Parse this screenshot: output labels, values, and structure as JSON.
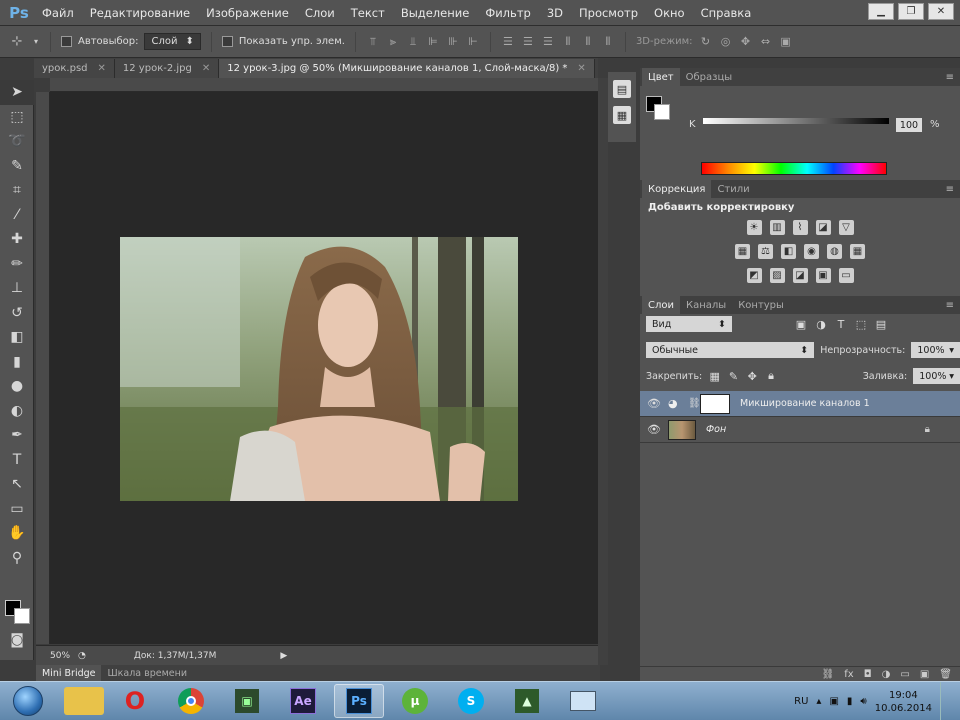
{
  "app": {
    "logo": "Ps"
  },
  "menu": [
    "Файл",
    "Редактирование",
    "Изображение",
    "Слои",
    "Текст",
    "Выделение",
    "Фильтр",
    "3D",
    "Просмотр",
    "Окно",
    "Справка"
  ],
  "options": {
    "autoselect_label": "Автовыбор:",
    "autoselect_value": "Слой",
    "show_controls_label": "Показать упр. элем.",
    "mode3d_label": "3D-режим:"
  },
  "tabs": [
    {
      "label": "урок.psd",
      "active": false
    },
    {
      "label": "12 урок-2.jpg",
      "active": false
    },
    {
      "label": "12 урок-3.jpg @ 50% (Микширование каналов 1, Слой-маска/8) *",
      "active": true
    }
  ],
  "status": {
    "zoom": "50%",
    "doc": "Док: 1,37M/1,37M"
  },
  "bottom_tabs": [
    "Mini Bridge",
    "Шкала времени"
  ],
  "color_panel": {
    "tabs": [
      "Цвет",
      "Образцы"
    ],
    "channel": "K",
    "value": "100",
    "unit": "%"
  },
  "adjustments": {
    "tabs": [
      "Коррекция",
      "Стили"
    ],
    "title": "Добавить корректировку"
  },
  "layers_panel": {
    "tabs": [
      "Слои",
      "Каналы",
      "Контуры"
    ],
    "filter": "Вид",
    "blend_mode": "Обычные",
    "opacity_label": "Непрозрачность:",
    "opacity_value": "100%",
    "lock_label": "Закрепить:",
    "fill_label": "Заливка:",
    "fill_value": "100%",
    "layers": [
      {
        "name": "Микширование каналов 1",
        "selected": true
      },
      {
        "name": "Фон",
        "selected": false
      }
    ]
  },
  "taskbar": {
    "lang": "RU",
    "time": "19:04",
    "date": "10.06.2014",
    "apps": [
      "explorer",
      "opera",
      "chrome",
      "camtasia",
      "Ae",
      "Ps",
      "utorrent",
      "skype",
      "app-green",
      "app-window"
    ]
  }
}
